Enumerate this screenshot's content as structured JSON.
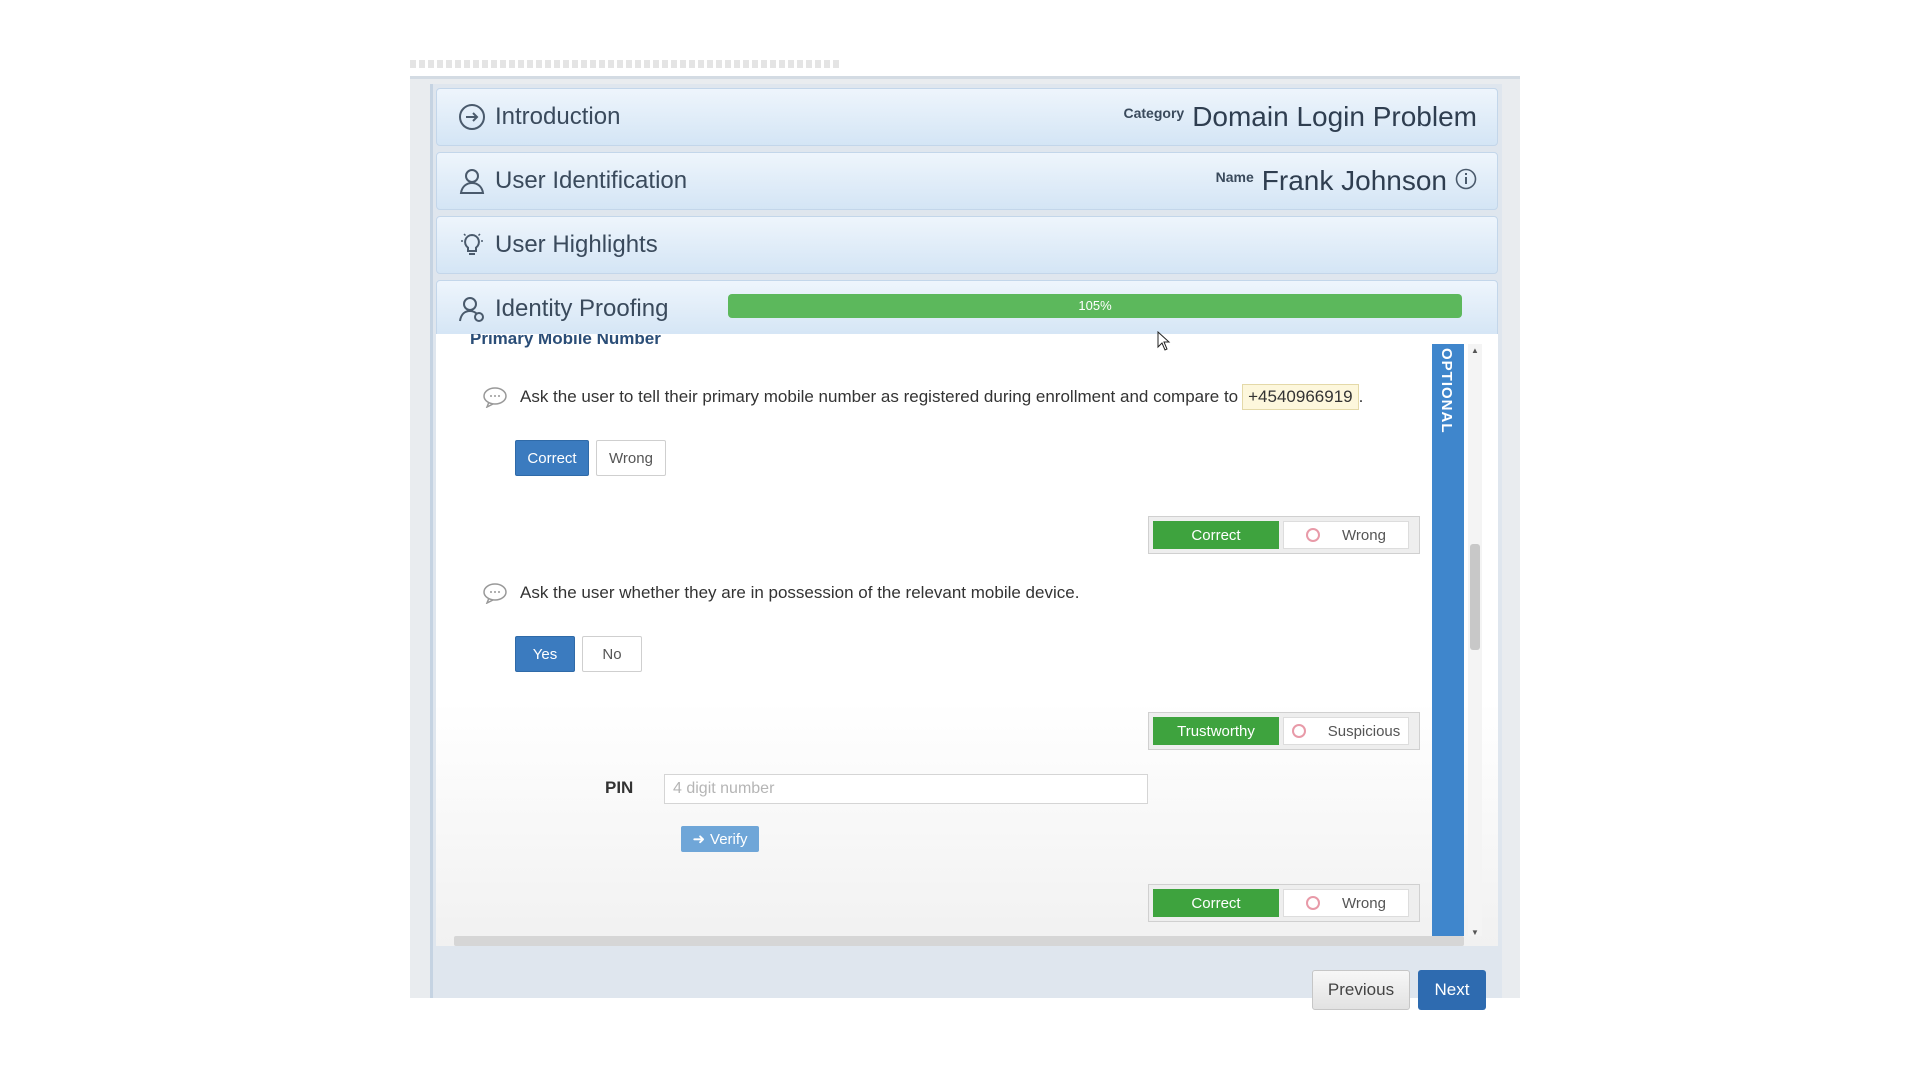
{
  "progress": {
    "label": "105%",
    "percent": 105
  },
  "accordion": [
    {
      "title": "Introduction",
      "right_label": "Category",
      "right_value": "Domain Login Problem",
      "icon": "arrow-circle-icon"
    },
    {
      "title": "User Identification",
      "right_label": "Name",
      "right_value": "Frank Johnson",
      "icon": "user-icon"
    },
    {
      "title": "User Highlights",
      "icon": "lightbulb-icon"
    },
    {
      "title": "Identity Proofing",
      "icon": "user-check-icon"
    }
  ],
  "section": {
    "title": "Primary Mobile Number"
  },
  "questions": [
    {
      "text": "Ask the user to tell their primary mobile number as registered during enrollment and compare to",
      "highlight": "+4540966919",
      "suffix": ".",
      "options": [
        "Correct",
        "Wrong"
      ],
      "judge": {
        "ok": "Correct",
        "bad": "Wrong"
      }
    },
    {
      "text": "Ask the user whether they are in possession of the relevant mobile device.",
      "options": [
        "Yes",
        "No"
      ],
      "judge": {
        "ok": "Trustworthy",
        "bad": "Suspicious"
      }
    }
  ],
  "pin": {
    "label": "PIN",
    "placeholder": "4 digit number",
    "verify_label": "Verify",
    "judge": {
      "ok": "Correct",
      "bad": "Wrong"
    }
  },
  "side_tab": "OPTIONAL",
  "footer": {
    "previous": "Previous",
    "next": "Next"
  },
  "colors": {
    "accent": "#3b7bbf",
    "success": "#3ea33e",
    "progress": "#5cb85c",
    "side_tab": "#3f86cc"
  }
}
